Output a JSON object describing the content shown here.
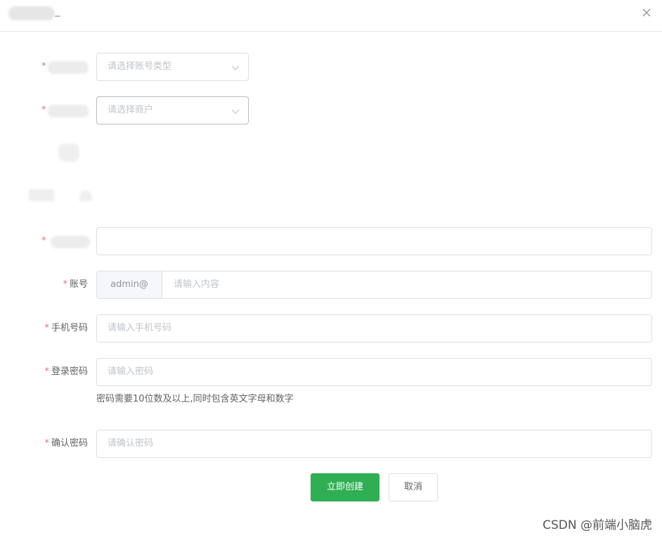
{
  "header": {
    "title": ""
  },
  "form": {
    "account_type": {
      "placeholder": "请选择账号类型"
    },
    "merchant": {
      "placeholder": "请选择商户"
    },
    "blurred_field": {
      "value": ""
    },
    "account": {
      "label": "账号",
      "prepend": "admin@",
      "placeholder": "请输入内容"
    },
    "phone": {
      "label": "手机号码",
      "placeholder": "请输入手机号码"
    },
    "password": {
      "label": "登录密码",
      "placeholder": "请输入密码",
      "hint": "密码需要10位数及以上,同时包含英文字母和数字"
    },
    "confirm": {
      "label": "确认密码",
      "placeholder": "请确认密码"
    },
    "required_mark": "*"
  },
  "actions": {
    "create": "立即创建",
    "cancel": "取消"
  },
  "watermark": "CSDN @前端小脑虎",
  "colors": {
    "primary": "#2fae53",
    "required": "#f56c6c",
    "border": "#dcdfe6",
    "placeholder": "#c0c4cc"
  },
  "icons": {
    "close": "close-icon",
    "select_arrow": "chevron-down-icon"
  }
}
